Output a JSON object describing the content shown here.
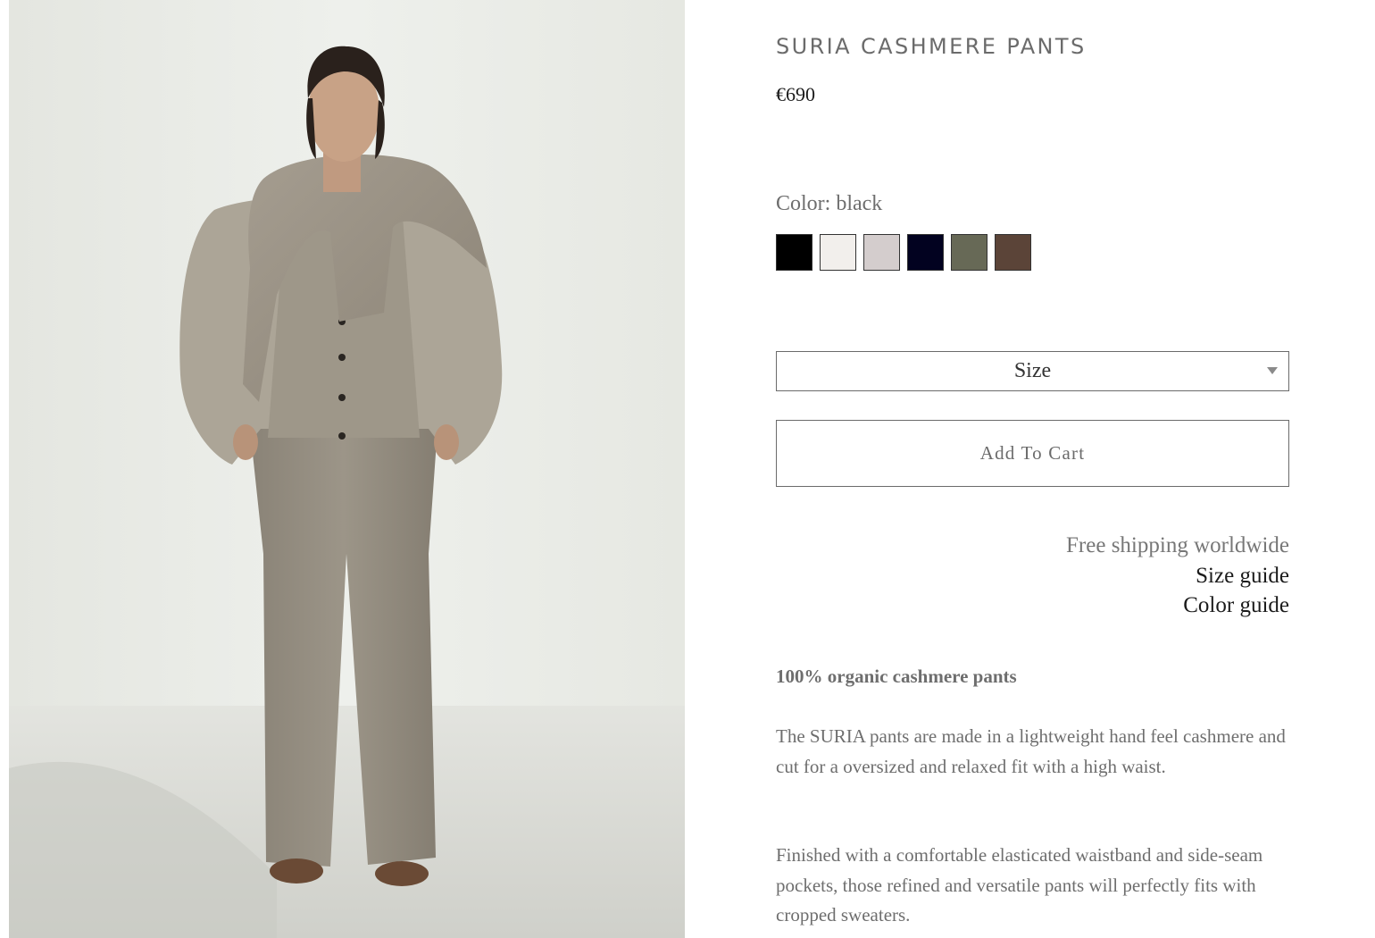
{
  "product": {
    "title": "SURIA CASHMERE PANTS",
    "price": "€690",
    "image_alt": "Model wearing SURIA cashmere pants"
  },
  "color": {
    "label": "Color: black",
    "swatches": [
      {
        "name": "black",
        "hex": "#000000"
      },
      {
        "name": "ivory",
        "hex": "#f2efec"
      },
      {
        "name": "light grey",
        "hex": "#d4cdcd"
      },
      {
        "name": "navy",
        "hex": "#020220"
      },
      {
        "name": "olive",
        "hex": "#676956"
      },
      {
        "name": "brown",
        "hex": "#5b4438"
      }
    ]
  },
  "size_select": {
    "label": "Size"
  },
  "cart": {
    "button_label": "Add To Cart"
  },
  "info_links": {
    "shipping": "Free shipping worldwide",
    "size_guide": "Size guide",
    "color_guide": "Color guide"
  },
  "description": {
    "heading": "100% organic cashmere pants",
    "paragraph1": "The SURIA pants are made in a lightweight hand feel cashmere and cut for a oversized and relaxed fit with a high waist.",
    "paragraph2": "Finished with a comfortable elasticated waistband and side-seam pockets, those refined and versatile pants will perfectly fits with cropped sweaters."
  }
}
